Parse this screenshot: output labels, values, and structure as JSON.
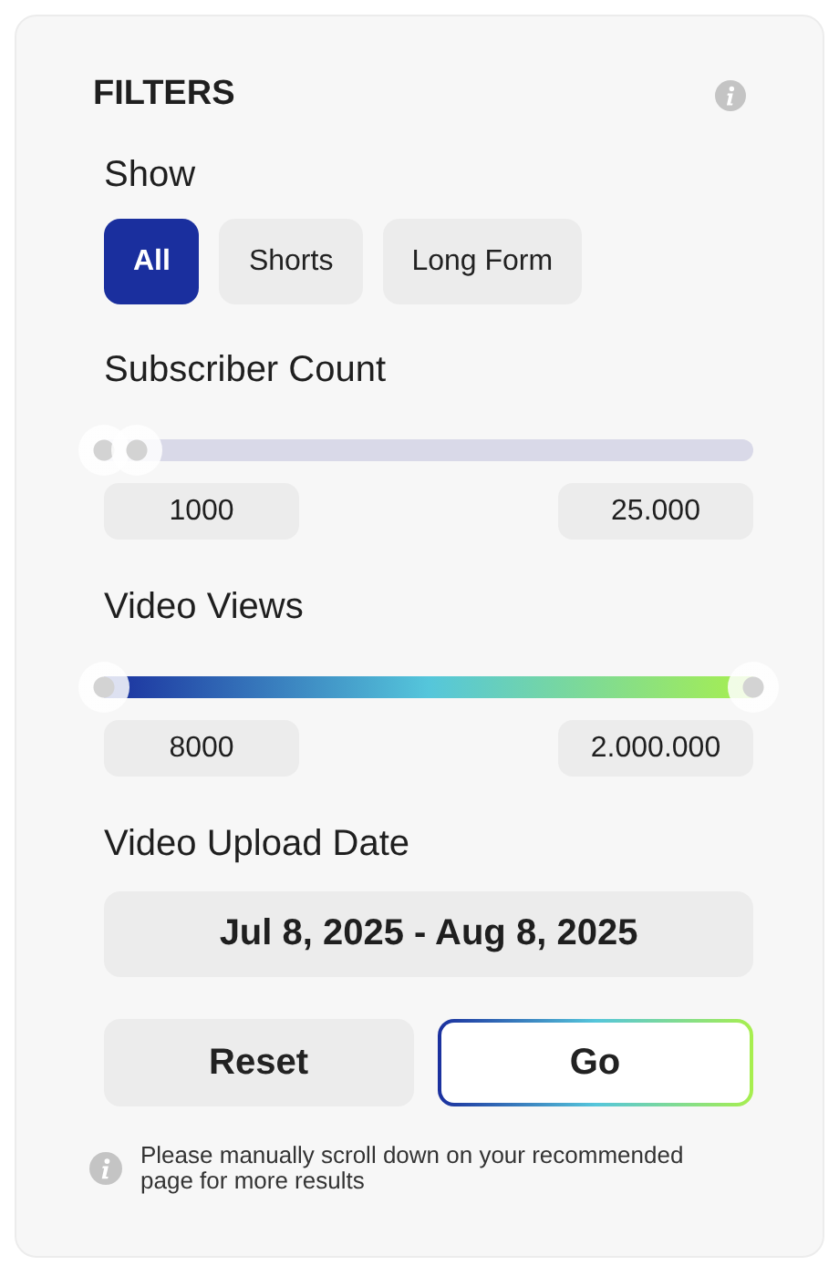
{
  "title": "FILTERS",
  "show": {
    "label": "Show",
    "options": [
      {
        "label": "All",
        "selected": true
      },
      {
        "label": "Shorts",
        "selected": false
      },
      {
        "label": "Long Form",
        "selected": false
      }
    ]
  },
  "ranges": [
    {
      "label": "Subscriber Count",
      "kind": "plain",
      "thumbs": [
        {
          "level": 0.0
        },
        {
          "level": 0.05
        }
      ],
      "min": "1000",
      "max": "25.000"
    },
    {
      "label": "Video Views",
      "kind": "gradient",
      "thumbs": [
        {
          "level": 0.0
        },
        {
          "level": 1.0
        }
      ],
      "min": "8000",
      "max": "2.000.000"
    }
  ],
  "date": {
    "label": "Video Upload Date",
    "value": "Jul 8, 2025 - Aug 8, 2025"
  },
  "buttons": [
    {
      "label": "Reset",
      "kind": "plain"
    },
    {
      "label": "Go",
      "kind": "primary"
    }
  ],
  "note": "Please manually scroll down on your recommended page for more results"
}
